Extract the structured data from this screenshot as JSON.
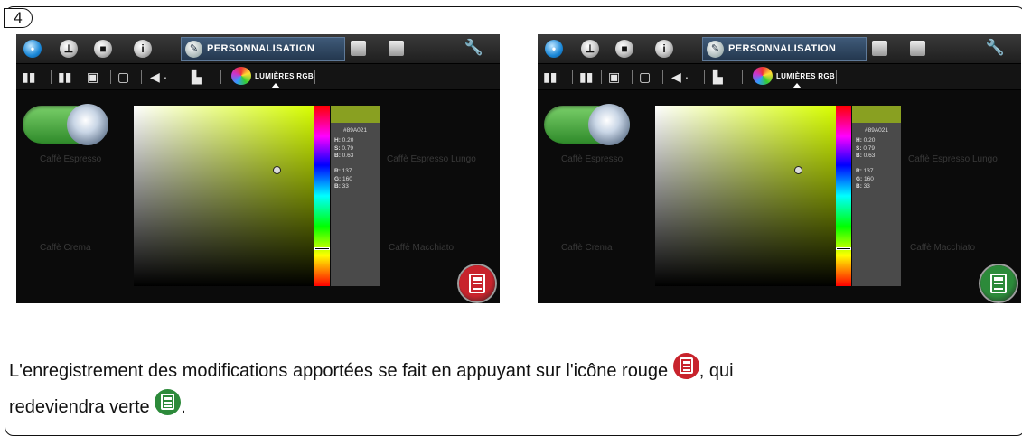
{
  "step": "4",
  "screens": [
    {
      "tab_active": "PERSONNALISATION",
      "subtab_active": "LUMIÈRES RGB",
      "bg_labels": [
        "Caffè Espresso",
        "Caffè Espresso Lungo",
        "Caffè Crema",
        "Caffè Macchiato"
      ],
      "hex": "#89A021",
      "hsb": {
        "h": "0.20",
        "s": "0.79",
        "b": "0.63"
      },
      "rgb": {
        "r": "137",
        "g": "160",
        "b": "33"
      },
      "save_state": "unsaved",
      "save_color": "#c8232c"
    },
    {
      "tab_active": "PERSONNALISATION",
      "subtab_active": "LUMIÈRES RGB",
      "bg_labels": [
        "Caffè Espresso",
        "Caffè Espresso Lungo",
        "Caffè Crema",
        "Caffè Macchiato"
      ],
      "hex": "#89A021",
      "hsb": {
        "h": "0.20",
        "s": "0.79",
        "b": "0.63"
      },
      "rgb": {
        "r": "137",
        "g": "160",
        "b": "33"
      },
      "save_state": "saved",
      "save_color": "#2c8a3a"
    }
  ],
  "colors": {
    "selected": "#89A021",
    "hue": "#d8ff00",
    "red_icon": "#c8232c",
    "green_icon": "#2c8a3a"
  },
  "caption": {
    "line1": "L'enregistrement des modifications apportées se fait en appuyant sur l'icône rouge",
    "line1_end": ", qui",
    "line2": "redeviendra verte",
    "line2_end": "."
  }
}
